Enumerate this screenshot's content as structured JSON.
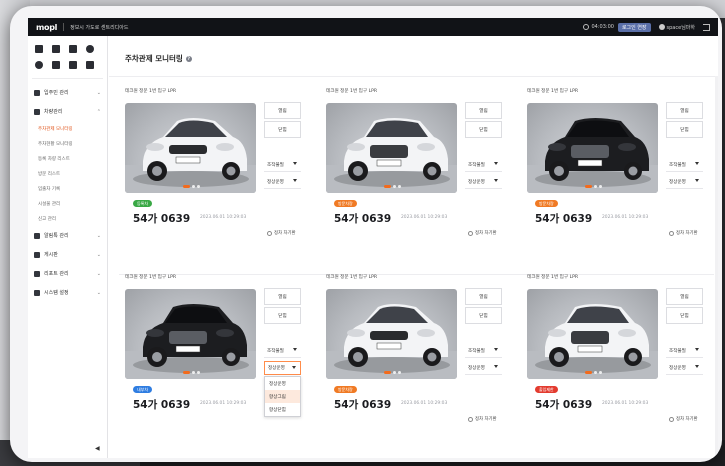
{
  "topbar": {
    "logo": "mopl",
    "breadcrumb": "정보시 가도로 센트리디아드",
    "timer": "04:03:00",
    "extend_label": "로그인 연장",
    "user": "space님마하",
    "colors": {
      "bar": "#111317",
      "accent": "#5a6fa8"
    }
  },
  "sidebar": {
    "quick_icons": [
      "home-icon",
      "car-icon",
      "calendar-icon",
      "gear-icon",
      "alarm-icon",
      "user-group-icon",
      "arrow-icon",
      "parking-icon"
    ],
    "items": [
      {
        "icon": "user-icon",
        "label": "입주민 관리",
        "expanded": false
      },
      {
        "icon": "car-icon",
        "label": "차량관리",
        "expanded": true,
        "children": [
          {
            "label": "주차관제 모니터링",
            "active": true
          },
          {
            "label": "주차현황 모니터링",
            "active": false
          },
          {
            "label": "등록 차량 리스트",
            "active": false
          },
          {
            "label": "방문 리스트",
            "active": false
          },
          {
            "label": "입출차 기록",
            "active": false
          },
          {
            "label": "시설물 관리",
            "active": false
          },
          {
            "label": "신고 관리",
            "active": false
          }
        ]
      },
      {
        "icon": "speaker-icon",
        "label": "알림톡 관리",
        "expanded": false
      },
      {
        "icon": "message-icon",
        "label": "게시판",
        "expanded": false
      },
      {
        "icon": "chart-icon",
        "label": "리포트 관리",
        "expanded": false
      },
      {
        "icon": "settings-icon",
        "label": "시스템 설정",
        "expanded": false
      }
    ],
    "collapse_glyph": "◀"
  },
  "main": {
    "title": "주차관제 모니터링",
    "help_glyph": "?",
    "cards": [
      {
        "label": "테크원 정문 1번 입구 LPR",
        "car": "white-hatch",
        "badge": "등록차",
        "badge_color": "#39a845",
        "plate": "54가 0639",
        "time": "2023.06.01 10:29:03",
        "open_label": "열림",
        "close_label": "닫힘",
        "select1": "조작불필",
        "select2": "정상운영",
        "radio_label": "정차 차기환",
        "dropdown_open": false
      },
      {
        "label": "테크원 정문 1번 입구 LPR",
        "car": "white-sedan",
        "badge": "방문차량",
        "badge_color": "#f07a24",
        "plate": "54가 0639",
        "time": "2023.06.01 10:29:03",
        "open_label": "열림",
        "close_label": "닫힘",
        "select1": "조작불필",
        "select2": "정상운영",
        "radio_label": "정차 차기환",
        "dropdown_open": false
      },
      {
        "label": "테크원 정문 1번 입구 LPR",
        "car": "black-sedan",
        "badge": "방문차량",
        "badge_color": "#f07a24",
        "plate": "54가 0639",
        "time": "2023.06.01 10:29:03",
        "open_label": "열림",
        "close_label": "닫힘",
        "select1": "조작불필",
        "select2": "정상운영",
        "radio_label": "정차 차기환",
        "dropdown_open": false
      },
      {
        "label": "테크원 정문 1번 입구 LPR",
        "car": "black-sedan",
        "badge": "내부차",
        "badge_color": "#2f7de1",
        "plate": "54가 0639",
        "time": "2023.06.01 10:29:03",
        "open_label": "열림",
        "close_label": "닫힘",
        "select1": "조작불필",
        "select2": "정상운영",
        "radio_label": "",
        "dropdown_open": true
      },
      {
        "label": "테크원 정문 1번 입구 LPR",
        "car": "white-hatch",
        "badge": "방문차량",
        "badge_color": "#f07a24",
        "plate": "54가 0639",
        "time": "2023.06.01 10:29:03",
        "open_label": "열림",
        "close_label": "닫힘",
        "select1": "조작불필",
        "select2": "정상운영",
        "radio_label": "정차 차기환",
        "dropdown_open": false
      },
      {
        "label": "테크원 정문 1번 입구 LPR",
        "car": "white-sedan",
        "badge": "출입제한",
        "badge_color": "#e33b2f",
        "plate": "54가 0639",
        "time": "2023.06.01 10:29:03",
        "open_label": "열림",
        "close_label": "닫힘",
        "select1": "조작불필",
        "select2": "정상운영",
        "radio_label": "정차 차기환",
        "dropdown_open": false
      }
    ],
    "dropdown_options": [
      {
        "label": "정상운영",
        "highlighted": false
      },
      {
        "label": "항상그림",
        "highlighted": true
      },
      {
        "label": "항상닫힘",
        "highlighted": false
      }
    ],
    "accent_color": "#f26b1d"
  }
}
